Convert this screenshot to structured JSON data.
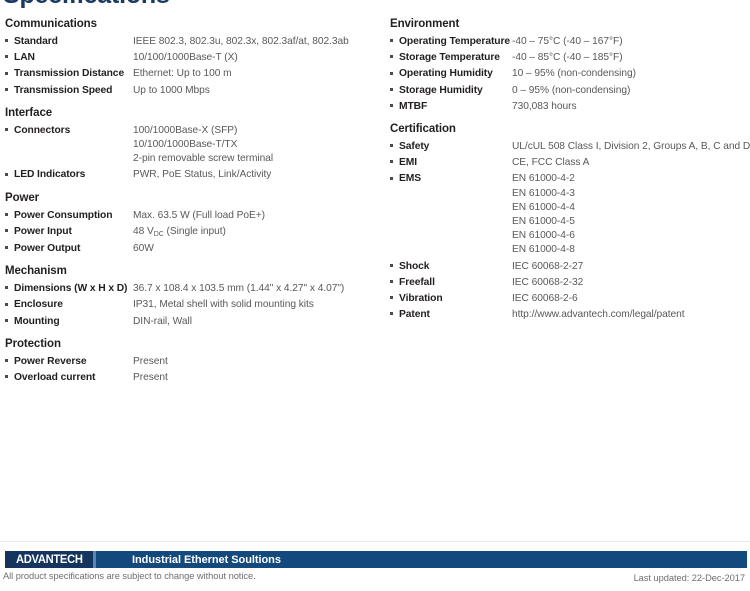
{
  "page": {
    "title": "Specifications"
  },
  "columns": {
    "left": [
      {
        "id": "communications",
        "title": "Communications",
        "rows": [
          {
            "label": "Standard",
            "values": [
              "IEEE 802.3, 802.3u, 802.3x, 802.3af/at, 802.3ab"
            ]
          },
          {
            "label": "LAN",
            "values": [
              "10/100/1000Base-T (X)"
            ]
          },
          {
            "label": "Transmission Distance",
            "values": [
              "Ethernet: Up to 100 m"
            ]
          },
          {
            "label": "Transmission Speed",
            "values": [
              "Up to 1000 Mbps"
            ]
          }
        ]
      },
      {
        "id": "interface",
        "title": "Interface",
        "rows": [
          {
            "label": "Connectors",
            "values": [
              "100/1000Base-X (SFP)",
              "10/100/1000Base-T/TX",
              "2-pin removable screw terminal"
            ]
          },
          {
            "label": "LED Indicators",
            "values": [
              "PWR, PoE Status, Link/Activity"
            ]
          }
        ]
      },
      {
        "id": "power",
        "title": "Power",
        "rows": [
          {
            "label": "Power Consumption",
            "values": [
              "Max. 63.5 W (Full load PoE+)"
            ]
          },
          {
            "label": "Power Input",
            "values": [
              "48 V<sub>DC</sub> (Single input)"
            ],
            "html": true
          },
          {
            "label": "Power Output",
            "values": [
              "60W"
            ]
          }
        ]
      },
      {
        "id": "mechanism",
        "title": "Mechanism",
        "rows": [
          {
            "label": "Dimensions (W x H x D)",
            "values": [
              "36.7 x 108.4 x 103.5 mm (1.44\" x 4.27\" x 4.07\")"
            ]
          },
          {
            "label": "Enclosure",
            "values": [
              "IP31, Metal shell with solid mounting kits"
            ]
          },
          {
            "label": "Mounting",
            "values": [
              "DIN-rail, Wall"
            ]
          }
        ]
      },
      {
        "id": "protection",
        "title": "Protection",
        "rows": [
          {
            "label": "Power Reverse",
            "values": [
              "Present"
            ]
          },
          {
            "label": "Overload current",
            "values": [
              "Present"
            ]
          }
        ]
      }
    ],
    "right": [
      {
        "id": "environment",
        "title": "Environment",
        "rows": [
          {
            "label": "Operating Temperature",
            "values": [
              "-40 – 75°C  (-40 – 167°F)"
            ]
          },
          {
            "label": "Storage Temperature",
            "values": [
              "-40 – 85°C  (-40 – 185°F)"
            ]
          },
          {
            "label": "Operating Humidity",
            "values": [
              "10 – 95% (non-condensing)"
            ]
          },
          {
            "label": "Storage Humidity",
            "values": [
              "0 – 95% (non-condensing)"
            ]
          },
          {
            "label": "MTBF",
            "values": [
              "730,083 hours"
            ]
          }
        ]
      },
      {
        "id": "certification",
        "title": "Certification",
        "rows": [
          {
            "label": "Safety",
            "values": [
              "UL/cUL 508 Class I, Division 2, Groups A, B, C and D"
            ]
          },
          {
            "label": "EMI",
            "values": [
              "CE, FCC Class A"
            ]
          },
          {
            "label": "EMS",
            "values": [
              "EN 61000-4-2",
              "EN 61000-4-3",
              "EN 61000-4-4",
              "EN 61000-4-5",
              "EN 61000-4-6",
              "EN 61000-4-8"
            ]
          },
          {
            "label": "Shock",
            "values": [
              "IEC 60068-2-27"
            ]
          },
          {
            "label": "Freefall",
            "values": [
              "IEC 60068-2-32"
            ]
          },
          {
            "label": "Vibration",
            "values": [
              "IEC 60068-2-6"
            ]
          },
          {
            "label": "Patent",
            "values": [
              "http://www.advantech.com/legal/patent"
            ]
          }
        ]
      }
    ]
  },
  "footer": {
    "logo_text": "ADVANTECH",
    "bar_title": "Industrial Ethernet Soultions",
    "note": "All product specifications are subject to change without notice.",
    "updated": "Last updated: 22-Dec-2017",
    "bar_color": "#14497e",
    "logo_color": "#13355e",
    "title_color": "#1b3a63"
  }
}
